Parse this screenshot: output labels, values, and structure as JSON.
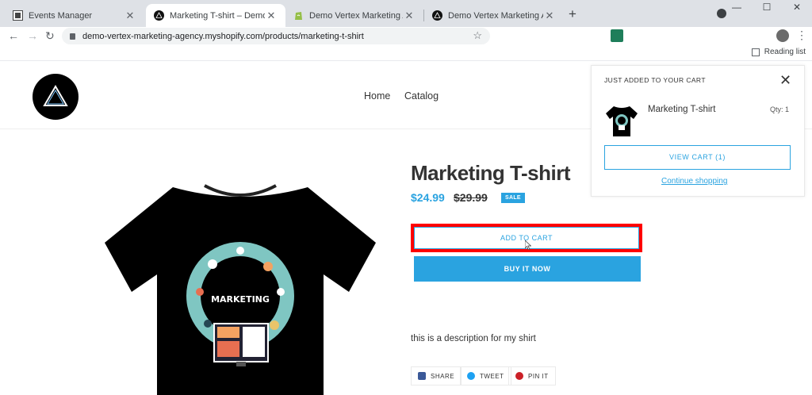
{
  "browser": {
    "tabs": [
      {
        "title": "Events Manager",
        "active": false
      },
      {
        "title": "Marketing T-shirt – Demo Vertex",
        "active": true
      },
      {
        "title": "Demo Vertex Marketing Agency",
        "active": false
      },
      {
        "title": "Demo Vertex Marketing Agency",
        "active": false
      }
    ],
    "close_glyph": "✕",
    "new_tab_glyph": "+",
    "url": "demo-vertex-marketing-agency.myshopify.com/products/marketing-t-shirt",
    "reading_list_label": "Reading list",
    "window_controls": [
      "—",
      "☐",
      "✕"
    ]
  },
  "store": {
    "nav": [
      "Home",
      "Catalog"
    ]
  },
  "product": {
    "title": "Marketing T-shirt",
    "price": "$24.99",
    "compare_price": "$29.99",
    "sale_badge": "SALE",
    "add_to_cart_label": "ADD TO CART",
    "buy_now_label": "BUY IT NOW",
    "description": "this is a description for my shirt",
    "image_text": "MARKETING",
    "share": [
      {
        "label": "SHARE",
        "icon": "facebook-icon",
        "color": "#3b5998"
      },
      {
        "label": "TWEET",
        "icon": "twitter-icon",
        "color": "#1da1f2"
      },
      {
        "label": "PIN IT",
        "icon": "pinterest-icon",
        "color": "#cb2027"
      }
    ]
  },
  "cart_popup": {
    "heading": "JUST ADDED TO YOUR CART",
    "product_name": "Marketing T-shirt",
    "quantity": "Qty: 1",
    "view_cart_label": "VIEW CART (1)",
    "continue_label": "Continue shopping"
  },
  "colors": {
    "accent": "#2aa3e0",
    "highlight_border": "#ff0000"
  }
}
